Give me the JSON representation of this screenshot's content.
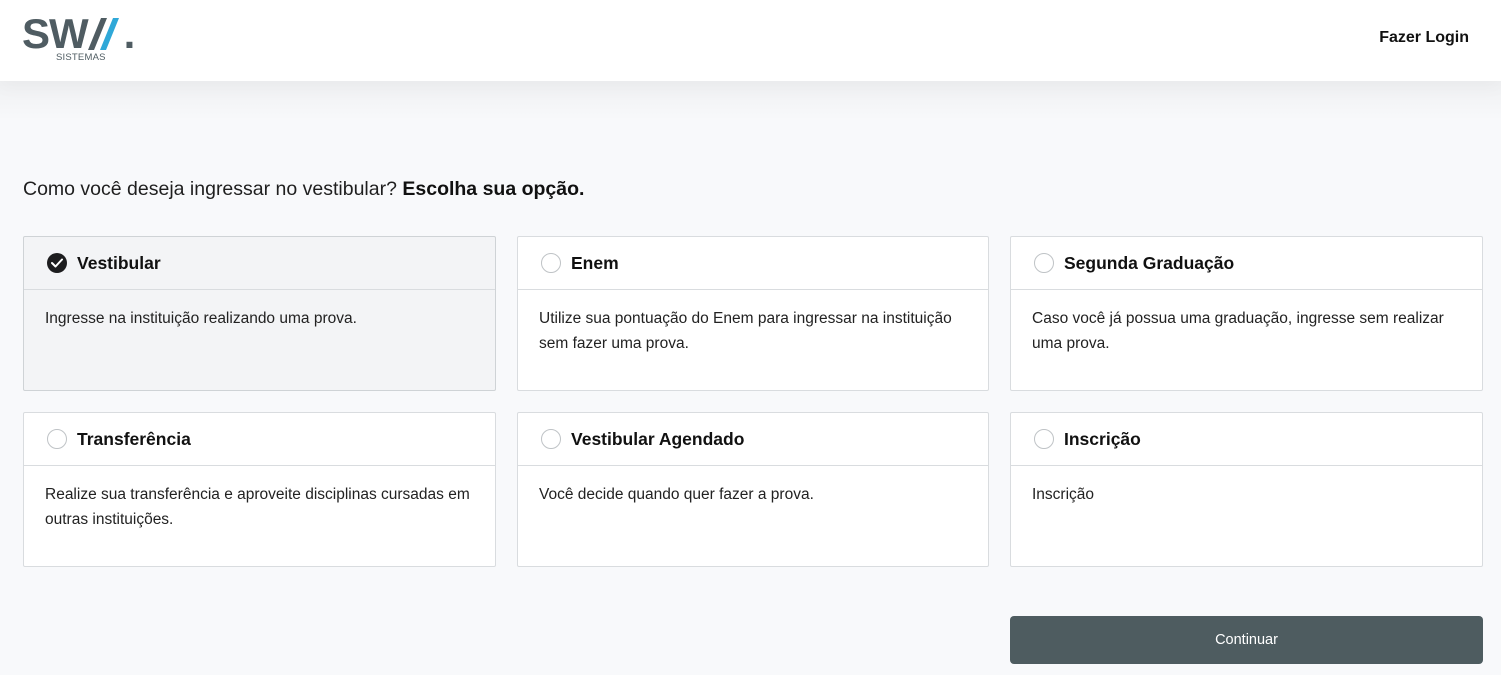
{
  "header": {
    "logo_text": "SW",
    "logo_accent": "/⁄",
    "logo_dot": ".",
    "logo_sub": "SISTEMAS",
    "login_label": "Fazer Login"
  },
  "main": {
    "question_prefix": "Como você deseja ingressar no vestibular?",
    "question_emphasis": "Escolha sua opção."
  },
  "options": [
    {
      "title": "Vestibular",
      "description": "Ingresse na instituição realizando uma prova.",
      "selected": true
    },
    {
      "title": "Enem",
      "description": "Utilize sua pontuação do Enem para ingressar na instituição sem fazer uma prova.",
      "selected": false
    },
    {
      "title": "Segunda Graduação",
      "description": "Caso você já possua uma graduação, ingresse sem realizar uma prova.",
      "selected": false
    },
    {
      "title": "Transferência",
      "description": "Realize sua transferência e aproveite disciplinas cursadas em outras instituições.",
      "selected": false
    },
    {
      "title": "Vestibular Agendado",
      "description": "Você decide quando quer fazer a prova.",
      "selected": false
    },
    {
      "title": "Inscrição",
      "description": "Inscrição",
      "selected": false
    }
  ],
  "footer": {
    "continue_label": "Continuar"
  },
  "colors": {
    "button_bg": "#4e5c60",
    "logo_gray": "#4f5c62",
    "logo_accent": "#2fa8d8",
    "selected_card_bg": "#f3f4f6"
  }
}
